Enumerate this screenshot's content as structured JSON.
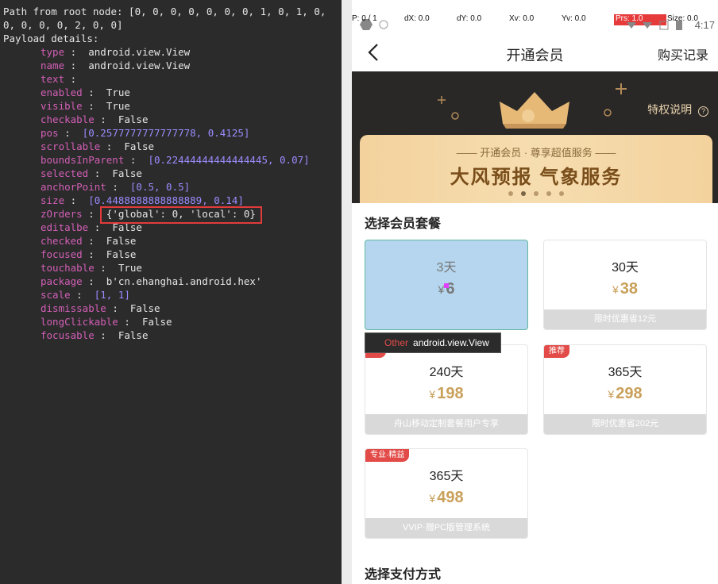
{
  "inspector": {
    "path_line1": "Path from root node: [0, 0, 0, 0, 0, 0, 0, 1, 0, 1, 0,",
    "path_line2": "0, 0, 0, 0, 2, 0, 0]",
    "payload_header": "Payload details:",
    "rows": [
      {
        "key": "type",
        "sep": " :  ",
        "value": "android.view.View",
        "style": "s"
      },
      {
        "key": "name",
        "sep": " :  ",
        "value": "android.view.View",
        "style": "s"
      },
      {
        "key": "text",
        "sep": " :",
        "value": "",
        "style": "s"
      },
      {
        "key": "enabled",
        "sep": " :  ",
        "value": "True",
        "style": "s"
      },
      {
        "key": "visible",
        "sep": " :  ",
        "value": "True",
        "style": "s"
      },
      {
        "key": "checkable",
        "sep": " :  ",
        "value": "False",
        "style": "s"
      },
      {
        "key": "pos",
        "sep": " :  ",
        "value": "[0.2577777777777778, 0.4125]",
        "style": "n"
      },
      {
        "key": "scrollable",
        "sep": " :  ",
        "value": "False",
        "style": "s"
      },
      {
        "key": "boundsInParent",
        "sep": " :  ",
        "value": "[0.22444444444444445, 0.07]",
        "style": "n"
      },
      {
        "key": "selected",
        "sep": " :  ",
        "value": "False",
        "style": "s"
      },
      {
        "key": "anchorPoint",
        "sep": " :  ",
        "value": "[0.5, 0.5]",
        "style": "n"
      },
      {
        "key": "size",
        "sep": " :  ",
        "value": "[0.4488888888888889, 0.14]",
        "style": "n"
      },
      {
        "key": "zOrders",
        "sep": " :  ",
        "value": "{'global': 0, 'local': 0}",
        "style": "s"
      },
      {
        "key": "editalbe",
        "sep": " :  ",
        "value": "False",
        "style": "s"
      },
      {
        "key": "checked",
        "sep": " :  ",
        "value": "False",
        "style": "s"
      },
      {
        "key": "focused",
        "sep": " :  ",
        "value": "False",
        "style": "s"
      },
      {
        "key": "touchable",
        "sep": " :  ",
        "value": "True",
        "style": "s"
      },
      {
        "key": "package",
        "sep": " :  ",
        "value": "b'cn.ehanghai.android.hex'",
        "style": "s"
      },
      {
        "key": "scale",
        "sep": " :  ",
        "value": "[1, 1]",
        "style": "n"
      },
      {
        "key": "dismissable",
        "sep": " :  ",
        "value": "False",
        "style": "s"
      },
      {
        "key": "longClickable",
        "sep": " :  ",
        "value": "False",
        "style": "s"
      },
      {
        "key": "focusable",
        "sep": " :  ",
        "value": "False",
        "style": "s"
      }
    ]
  },
  "debug": {
    "p": "P: 0 / 1",
    "dx": "dX: 0.0",
    "dy": "dY: 0.0",
    "xv": "Xv: 0.0",
    "yv": "Yv: 0.0",
    "prs": "Prs: 1.0",
    "size": "Size: 0.0",
    "clock": "4:17"
  },
  "topbar": {
    "title": "开通会员",
    "buy_record": "购买记录"
  },
  "banner": {
    "privilege": "特权说明",
    "subtitle": "—— 开通会员 · 尊享超值服务 ——",
    "headline": "大风预报 气象服务"
  },
  "packages": {
    "title": "选择会员套餐",
    "currency": "¥",
    "items": [
      {
        "days": "3天",
        "price": "6",
        "note": "",
        "tag": ""
      },
      {
        "days": "30天",
        "price": "38",
        "note": "限时优惠省12元",
        "tag": ""
      },
      {
        "days": "240天",
        "price": "198",
        "note": "舟山移动定制套餐用户专享",
        "tag": ""
      },
      {
        "days": "365天",
        "price": "298",
        "note": "限时优惠省202元",
        "tag": "推荐"
      },
      {
        "days": "365天",
        "price": "498",
        "note": "VVIP·赠PC版管理系统",
        "tag": "专业·精益"
      }
    ]
  },
  "tooltip": {
    "kind": "Other",
    "label": "android.view.View"
  },
  "payment": {
    "title": "选择支付方式"
  },
  "colors": {
    "accent_gold": "#c9a05a",
    "highlight_red": "#e23b3b",
    "selected_blue": "#b5d6ee"
  }
}
